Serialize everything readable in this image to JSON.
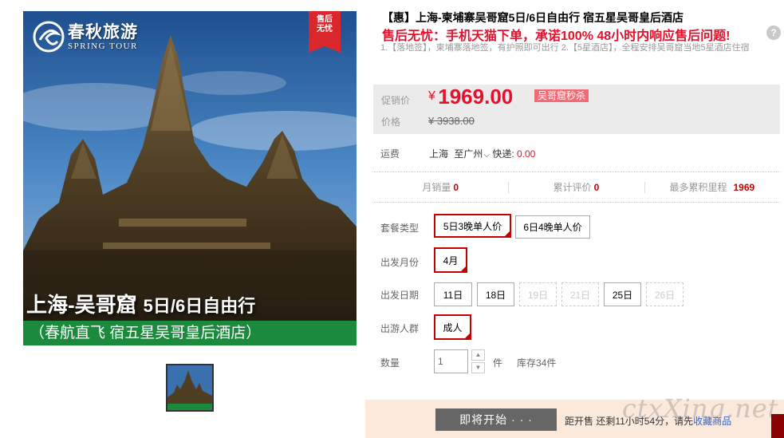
{
  "gallery": {
    "brand_cn": "春秋旅游",
    "brand_en": "SPRING TOUR",
    "ribbon_line1": "售后",
    "ribbon_line2": "无忧",
    "photo_title": "上海-吴哥窟",
    "photo_title_sub": "5日/6日自由行",
    "photo_band": "（春航直飞  宿五星吴哥皇后酒店）"
  },
  "product": {
    "title": "【惠】上海-柬埔寨吴哥窟5日/6日自由行 宿五星吴哥皇后酒店",
    "promo": "售后无忧：手机天猫下单，承诺100% 48小时内响应售后问题!",
    "help_icon": "?",
    "subtitle": "1.【落地签】，柬埔寨落地签，有护照即可出行 2.【5星酒店】，全程安排吴哥窟当地5星酒店住宿"
  },
  "price": {
    "promo_label": "促销价",
    "currency": "¥",
    "current": "1969.00",
    "tag": "吴哥窟秒杀",
    "orig_label": "价格",
    "original": "¥ 3938.00"
  },
  "shipping": {
    "label": "运费",
    "from": "上海",
    "to": "至广州",
    "method": "快递:",
    "fee": "0.00"
  },
  "stats": {
    "monthly_label": "月销量",
    "monthly_value": "0",
    "reviews_label": "累计评价",
    "reviews_value": "0",
    "points_label": "最多累积里程",
    "points_value": "1969"
  },
  "options": {
    "package_label": "套餐类型",
    "packages": [
      "5日3晚单人价",
      "6日4晚单人价"
    ],
    "month_label": "出发月份",
    "month": "4月",
    "date_label": "出发日期",
    "dates": [
      "11日",
      "18日",
      "19日",
      "21日",
      "25日",
      "26日"
    ],
    "people_label": "出游人群",
    "people": "成人",
    "qty_label": "数量",
    "qty_value": "1",
    "qty_unit": "件",
    "stock": "库存34件"
  },
  "buy": {
    "button": "即将开始 · · ·",
    "countdown_prefix": "距开售 还剩11小时54分，请先",
    "favorite_link": "收藏商品",
    "watermark": "ctxXing.net"
  },
  "colors": {
    "accent_red": "#e4112d",
    "green_band": "#1b8a3c",
    "selected_border": "#c40000",
    "buy_bar": "#fbe9dc"
  }
}
